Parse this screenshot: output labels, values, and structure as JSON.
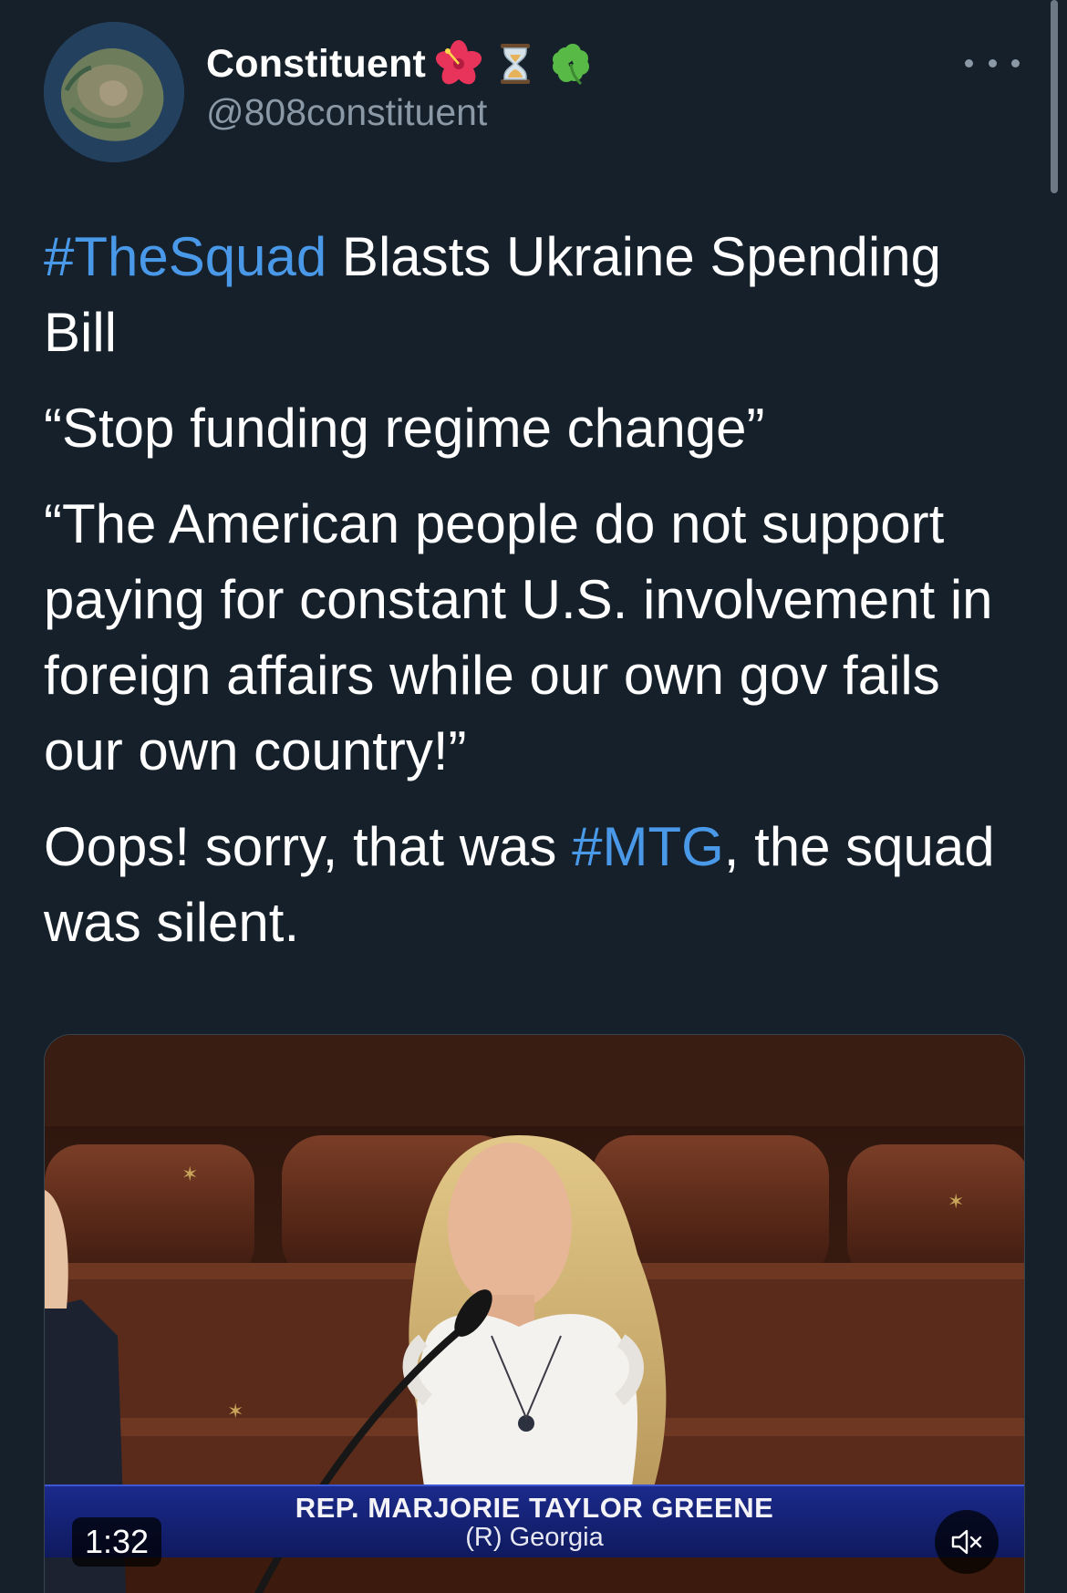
{
  "author": {
    "display_name": "Constituent",
    "handle": "@808constituent",
    "name_emojis": [
      "hibiscus-icon",
      "hourglass-icon",
      "four-leaf-clover-icon"
    ]
  },
  "tweet": {
    "line1_hashtag": "#TheSquad",
    "line1_rest": " Blasts Ukraine Spending Bill",
    "quote1": "“Stop funding regime change”",
    "quote2": "“The American people do not support paying for constant U.S. involvement in foreign affairs while our own gov fails our own country!”",
    "closing_before": "Oops! sorry, that was ",
    "closing_hashtag": "#MTG",
    "closing_after": ", the squad was silent."
  },
  "media": {
    "chyron_name": "REP. MARJORIE TAYLOR GREENE",
    "chyron_sub": "(R) Georgia",
    "duration": "1:32",
    "mute_icon": "speaker-muted-icon"
  },
  "colors": {
    "background": "#15202b",
    "hashtag": "#4a99e9",
    "secondary_text": "#8b98a5",
    "chyron_blue": "#142172"
  }
}
